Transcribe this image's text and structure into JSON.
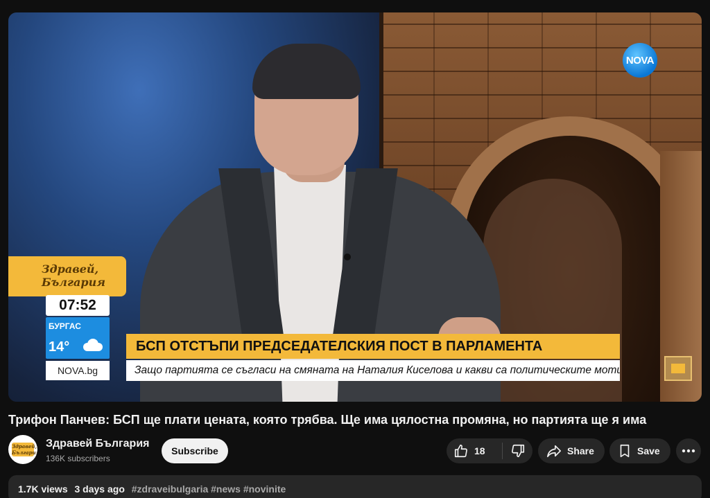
{
  "video": {
    "channel_logo_text": "NOVA",
    "show_badge": "Здравей, България",
    "clock": "07:52",
    "weather_city": "БУРГАС",
    "weather_temp": "14°",
    "site": "NOVA.bg",
    "headline": "БСП ОТСТЪПИ ПРЕДСЕДАТЕЛСКИЯ ПОСТ В ПАРЛАМЕНТА",
    "subheadline": "Защо партията се съгласи на смяната на Наталия Киселова и какви са политическите мотиви?"
  },
  "title": "Трифон Панчев: БСП ще плати цената, която трябва. Ще има цялостна промяна, но партията ще я има",
  "channel": {
    "name": "Здравей България",
    "subscribers": "136K subscribers",
    "avatar_text": "Здравей, България",
    "subscribe_label": "Subscribe"
  },
  "actions": {
    "likes": "18",
    "share_label": "Share",
    "save_label": "Save",
    "icons": [
      "thumbs-up-icon",
      "thumbs-down-icon",
      "share-icon",
      "bookmark-icon",
      "more-icon"
    ]
  },
  "description": {
    "views": "1.7K views",
    "date": "3 days ago",
    "hashtags": "#zdraveibulgaria #news #novinite"
  }
}
